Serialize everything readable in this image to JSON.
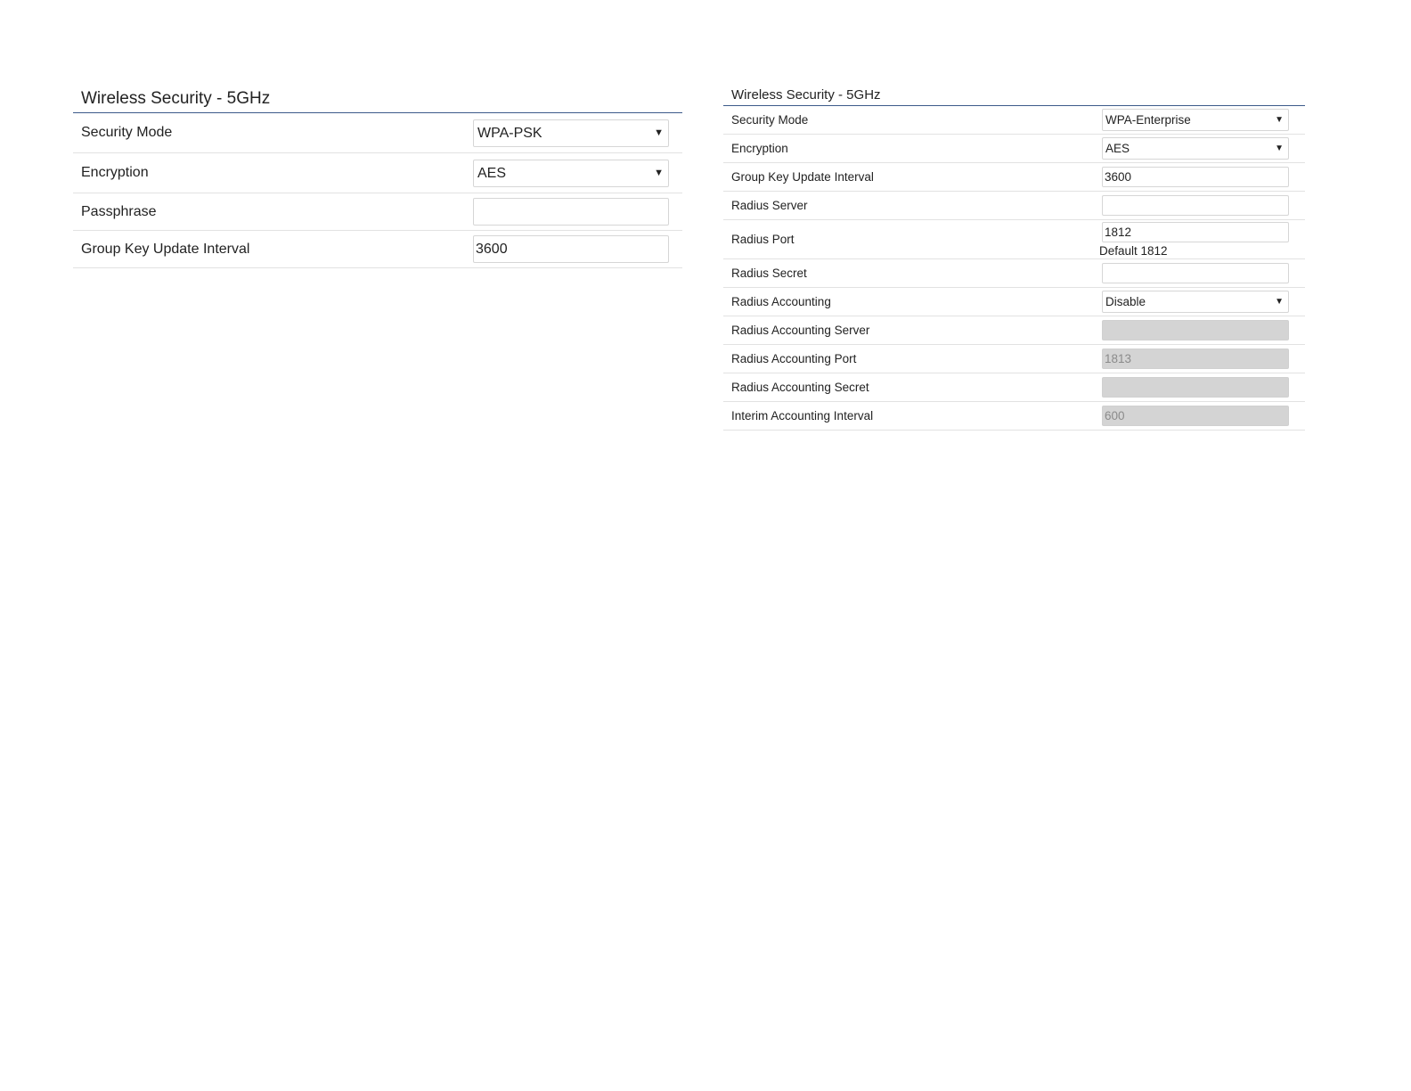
{
  "left_panel": {
    "title": "Wireless Security - 5GHz",
    "security_mode": {
      "label": "Security Mode",
      "value": "WPA-PSK"
    },
    "encryption": {
      "label": "Encryption",
      "value": "AES"
    },
    "passphrase": {
      "label": "Passphrase",
      "value": ""
    },
    "group_key_interval": {
      "label": "Group Key Update Interval",
      "value": "3600"
    }
  },
  "right_panel": {
    "title": "Wireless Security - 5GHz",
    "security_mode": {
      "label": "Security Mode",
      "value": "WPA-Enterprise"
    },
    "encryption": {
      "label": "Encryption",
      "value": "AES"
    },
    "group_key_interval": {
      "label": "Group Key Update Interval",
      "value": "3600"
    },
    "radius_server": {
      "label": "Radius Server",
      "value": ""
    },
    "radius_port": {
      "label": "Radius Port",
      "value": "1812",
      "hint": "Default 1812"
    },
    "radius_secret": {
      "label": "Radius Secret",
      "value": ""
    },
    "radius_accounting": {
      "label": "Radius Accounting",
      "value": "Disable"
    },
    "radius_accounting_server": {
      "label": "Radius Accounting Server",
      "value": ""
    },
    "radius_accounting_port": {
      "label": "Radius Accounting Port",
      "value": "1813"
    },
    "radius_accounting_secret": {
      "label": "Radius Accounting Secret",
      "value": ""
    },
    "interim_accounting_interval": {
      "label": "Interim Accounting Interval",
      "value": "600"
    }
  },
  "icons": {
    "dropdown_caret": "▼"
  },
  "colors": {
    "title_rule": "#3c5a8a",
    "disabled_field": "#d4d4d4"
  }
}
